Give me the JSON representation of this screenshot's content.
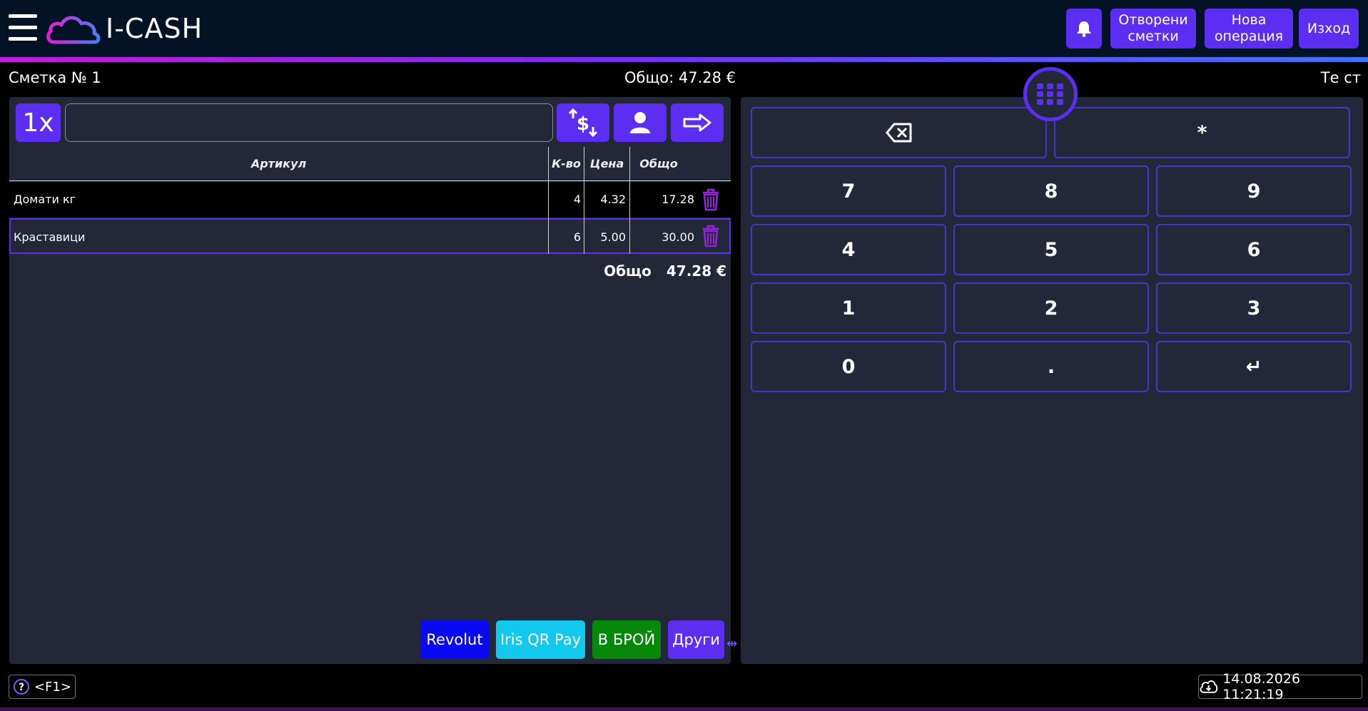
{
  "header": {
    "logo_text": "I-CASH",
    "open_bills_label": "Отворени\nсметки",
    "new_operation_label": "Нова\nоперация",
    "exit_label": "Изход",
    "accent": "#5b2ef2",
    "background": "#031224"
  },
  "info": {
    "bill_label": "Сметка № 1",
    "total_label": "Общо: 47.28 €",
    "user": "Те ст"
  },
  "toolbar": {
    "qty_label": "1x",
    "search_value": "",
    "icons": [
      "currency-exchange-icon",
      "customer-icon",
      "transfer-arrow-icon"
    ]
  },
  "table": {
    "headers": {
      "article": "Артикул",
      "qty": "К-во",
      "price": "Цена",
      "total": "Общо"
    },
    "rows": [
      {
        "name": "Домати кг",
        "qty": "4",
        "price": "4.32",
        "total": "17.28"
      },
      {
        "name": "Краставици",
        "qty": "6",
        "price": "5.00",
        "total": "30.00"
      }
    ],
    "sum_label": "Общо",
    "sum_value": "47.28 €"
  },
  "payments": {
    "revolut": {
      "label": "Revolut",
      "color": "#0a0af0"
    },
    "iris": {
      "label": "Iris QR Pay",
      "color": "#13c8ec"
    },
    "cash": {
      "label": "В БРОЙ",
      "color": "#06880a"
    },
    "other": {
      "label": "Други",
      "color": "#5b2ef2"
    }
  },
  "keypad": {
    "star": "*",
    "digits": [
      "7",
      "8",
      "9",
      "4",
      "5",
      "6",
      "1",
      "2",
      "3",
      "0"
    ],
    "dot": ".",
    "enter": "↵"
  },
  "footer": {
    "help_label": "<F1>",
    "datetime": "14.08.2026 11:21:19"
  }
}
